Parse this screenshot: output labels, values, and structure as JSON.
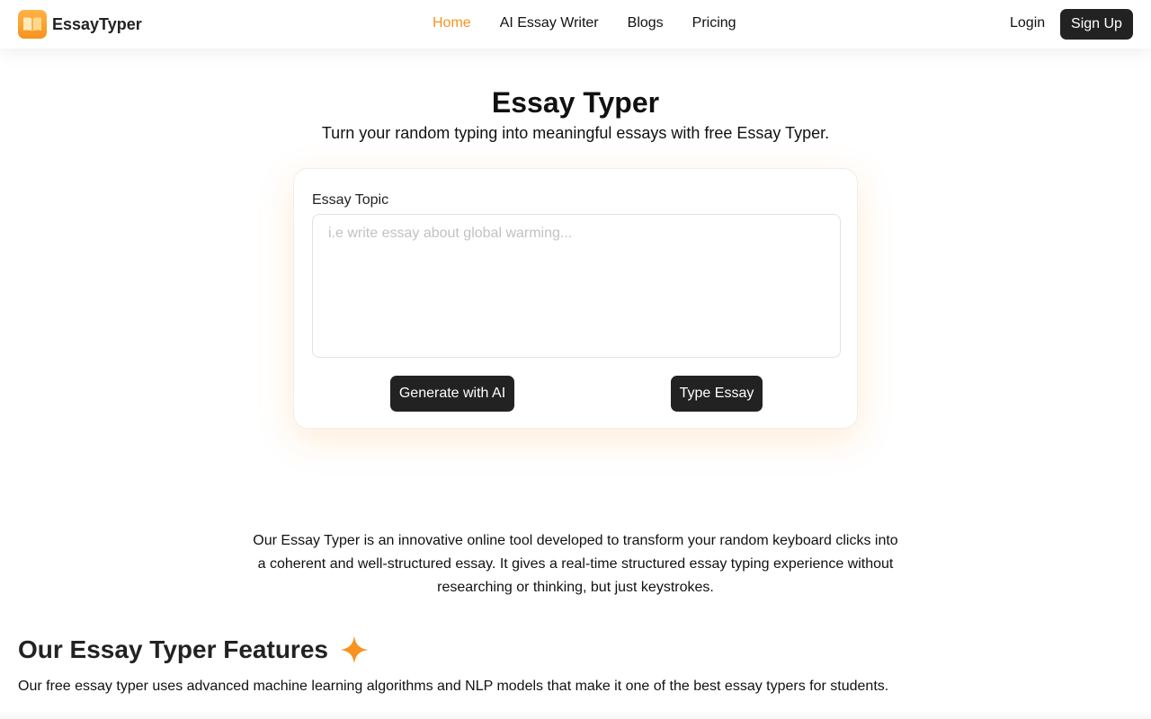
{
  "brand": {
    "name": "EssayTyper",
    "accent_color": "#f7931e",
    "logo_icon": "open-book-icon"
  },
  "nav": {
    "items": [
      {
        "label": "Home",
        "active": true
      },
      {
        "label": "AI Essay Writer",
        "active": false
      },
      {
        "label": "Blogs",
        "active": false
      },
      {
        "label": "Pricing",
        "active": false
      }
    ]
  },
  "auth": {
    "login_label": "Login",
    "signup_label": "Sign Up"
  },
  "hero": {
    "title": "Essay Typer",
    "subtitle": "Turn your random typing into meaningful essays with free Essay Typer."
  },
  "form": {
    "topic_label": "Essay Topic",
    "topic_value": "",
    "topic_placeholder": "i.e write essay about global warming...",
    "generate_label": "Generate with AI",
    "type_label": "Type Essay"
  },
  "description": "Our Essay Typer is an innovative online tool developed to transform your random keyboard clicks into a coherent and well-structured essay. It gives a real-time structured essay typing experience without researching or thinking, but just keystrokes.",
  "features": {
    "title": "Our Essay Typer Features",
    "title_icon": "sparkle-icon",
    "description": "Our free essay typer uses advanced machine learning algorithms and NLP models that make it one of the best essay typers for students."
  }
}
